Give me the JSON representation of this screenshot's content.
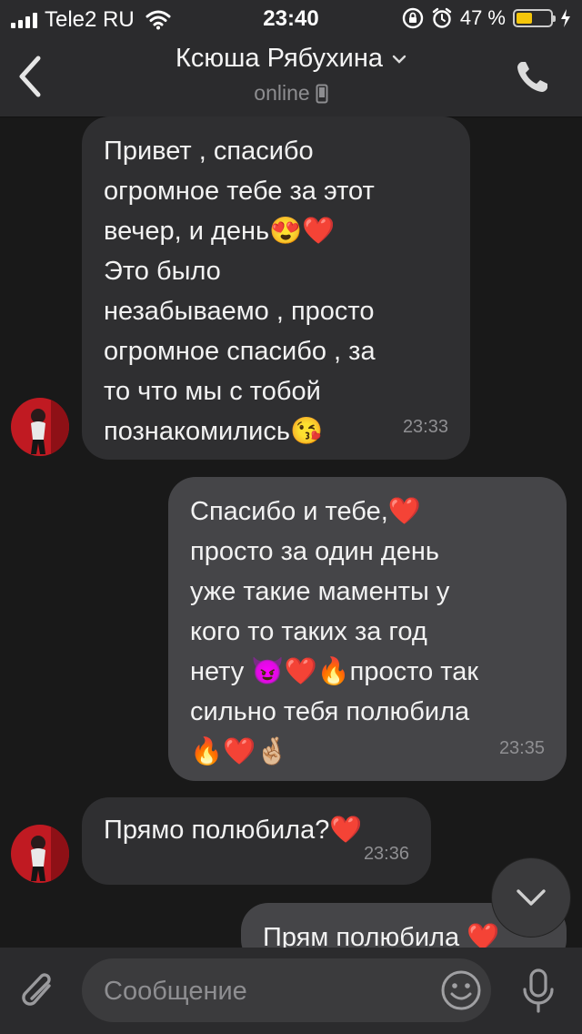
{
  "status_bar": {
    "carrier": "Tele2 RU",
    "time": "23:40",
    "battery_percent": "47 %",
    "battery_level": 0.47,
    "icons": [
      "signal-icon",
      "wifi-icon",
      "rotation-lock-icon",
      "alarm-icon",
      "battery-icon",
      "charging-bolt-icon"
    ]
  },
  "header": {
    "contact_name": "Ксюша Рябухина",
    "status": "online",
    "icons": [
      "back-chevron-icon",
      "chevron-down-icon",
      "mobile-device-icon",
      "phone-icon"
    ]
  },
  "messages": [
    {
      "direction": "incoming",
      "text": "Привет , спасибо\nогромное тебе за этот\nвечер, и день😍❤️\nЭто было\nнезабываемо , просто\nогромное спасибо , за\nто что мы с тобой\nпознакомились😘",
      "time": "23:33"
    },
    {
      "direction": "outgoing",
      "text": "Спасибо и тебе,❤️\nпросто за один день\nуже такие маменты у\nкого то таких за год\nнету 😈❤️🔥просто так\nсильно тебя полюбила\n🔥❤️🤞🏼",
      "time": "23:35"
    },
    {
      "direction": "incoming",
      "text": "Прямо полюбила?❤️",
      "time": "23:36"
    },
    {
      "direction": "outgoing",
      "text": "Прям полюбила ❤️",
      "time": ""
    }
  ],
  "input": {
    "placeholder": "Сообщение",
    "icons": [
      "attach-paperclip-icon",
      "emoji-smile-icon",
      "microphone-icon"
    ]
  },
  "scroll_down": {
    "icon": "chevron-down-icon"
  },
  "colors": {
    "background": "#191919",
    "bar": "#2b2b2d",
    "incoming_bubble": "#2f2f31",
    "outgoing_bubble": "#454548",
    "battery": "#f4c60b"
  }
}
